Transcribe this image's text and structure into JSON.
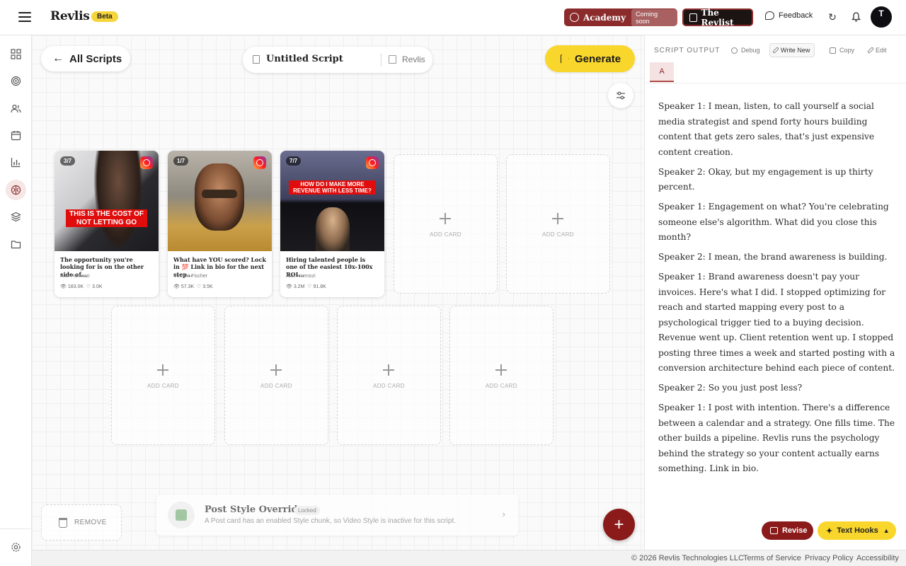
{
  "app": {
    "name": "Revlis",
    "badge": "Beta"
  },
  "header": {
    "academy_label": "Academy",
    "academy_badge": "Coming soon",
    "revlist_label": "The Revlist",
    "feedback_label": "Feedback",
    "avatar_initial": "T"
  },
  "toolbar": {
    "back_label": "All Scripts",
    "script_title": "Untitled Script",
    "brand_label": "Revlis",
    "generate_label": "Generate"
  },
  "cards": [
    {
      "count": "3/7",
      "overlay": "THIS IS THE COST OF NOT LETTING GO",
      "desc": "The opportunity you're looking for is on the other side of...",
      "author": "Alex Hormozi",
      "views": "183.0K",
      "likes": "3.0K"
    },
    {
      "count": "1/7",
      "overlay": "",
      "desc": "What have YOU scored? Lock in 💯 Link in bio for the next step...",
      "author": "Vincent Fischer",
      "views": "57.3K",
      "likes": "3.5K"
    },
    {
      "count": "7/7",
      "overlay": "HOW DO I MAKE MORE REVENUE WITH LESS TIME?",
      "desc": "Hiring talented people is one of the easiest 10x-100x ROI...",
      "author": "Alex Hormozi",
      "views": "3.2M",
      "likes": "91.8K"
    }
  ],
  "add_card_label": "ADD CARD",
  "remove_label": "REMOVE",
  "override": {
    "title": "Post Style Override",
    "badge": "Locked",
    "description": "A Post card has an enabled Style chunk, so Video Style is inactive for this script."
  },
  "panel": {
    "label": "SCRIPT OUTPUT",
    "tools": {
      "debug": "Debug",
      "write_new": "Write New",
      "copy": "Copy",
      "edit": "Edit"
    },
    "tab": "A",
    "script": [
      "Speaker 1: I mean, listen, to call yourself a social media strategist and spend forty hours building content that gets zero sales, that's just expensive content creation.",
      "Speaker 2: Okay, but my engagement is up thirty percent.",
      "Speaker 1: Engagement on what? You're celebrating someone else's algorithm. What did you close this month?",
      "Speaker 2: I mean, the brand awareness is building.",
      "Speaker 1: Brand awareness doesn't pay your invoices. Here's what I did. I stopped optimizing for reach and started mapping every post to a psychological trigger tied to a buying decision. Revenue went up. Client retention went up. I stopped posting three times a week and started posting with a conversion architecture behind each piece of content.",
      "Speaker 2: So you just post less?",
      "Speaker 1: I post with intention. There's a difference between a calendar and a strategy. One fills time. The other builds a pipeline. Revlis runs the psychology behind the strategy so your content actually earns something. Link in bio."
    ],
    "revise_label": "Revise",
    "hooks_label": "Text Hooks"
  },
  "footer": {
    "copyright": "© 2026 Revlis Technologies LLC",
    "terms": "Terms of Service",
    "privacy": "Privacy Policy",
    "accessibility": "Accessibility"
  },
  "colors": {
    "brand_red": "#8b1a1a",
    "accent_yellow": "#f9d62c"
  }
}
